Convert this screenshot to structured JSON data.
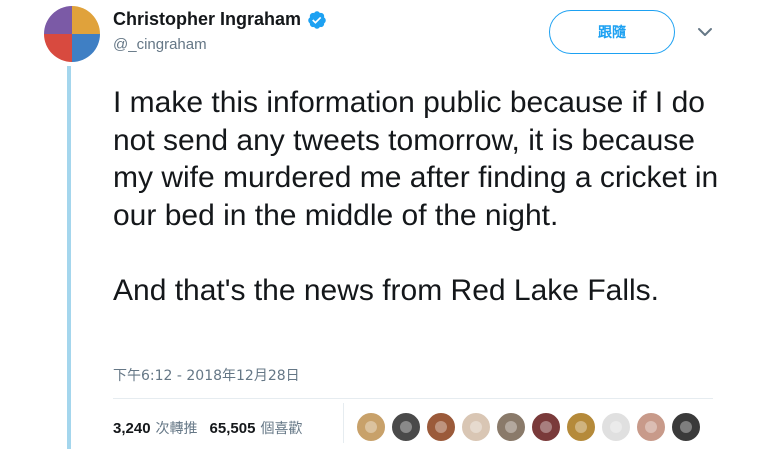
{
  "author": {
    "display_name": "Christopher Ingraham",
    "handle": "@_cingraham",
    "verified": true
  },
  "follow_button": {
    "label": "跟隨"
  },
  "tweet": {
    "paragraphs": [
      "I make this information public because if I do not send any tweets tomorrow, it is because my wife murdered me after finding a cricket in our bed in the middle of the night.",
      "And that's the news from Red Lake Falls."
    ],
    "timestamp": "下午6:12 - 2018年12月28日"
  },
  "stats": {
    "retweets": {
      "count": "3,240",
      "label": "次轉推"
    },
    "likes": {
      "count": "65,505",
      "label": "個喜歡"
    }
  },
  "likers": [
    {
      "icon": "avatar-cat",
      "color": "#c8a16a"
    },
    {
      "icon": "avatar-woman",
      "color": "#4a4a4a"
    },
    {
      "icon": "avatar-pet",
      "color": "#9b5a3a"
    },
    {
      "icon": "avatar-person",
      "color": "#d9c6b4"
    },
    {
      "icon": "avatar-couple",
      "color": "#8a7a6a"
    },
    {
      "icon": "avatar-man-suit",
      "color": "#7a3a3a"
    },
    {
      "icon": "avatar-woman",
      "color": "#b58a3a"
    },
    {
      "icon": "avatar-sketch",
      "color": "#e0e0e0"
    },
    {
      "icon": "avatar-portrait",
      "color": "#c89a8a"
    },
    {
      "icon": "avatar-group",
      "color": "#3a3a3a"
    }
  ],
  "colors": {
    "accent": "#1da1f2",
    "muted_text": "#657786",
    "thread_line": "#a4d6ed"
  }
}
